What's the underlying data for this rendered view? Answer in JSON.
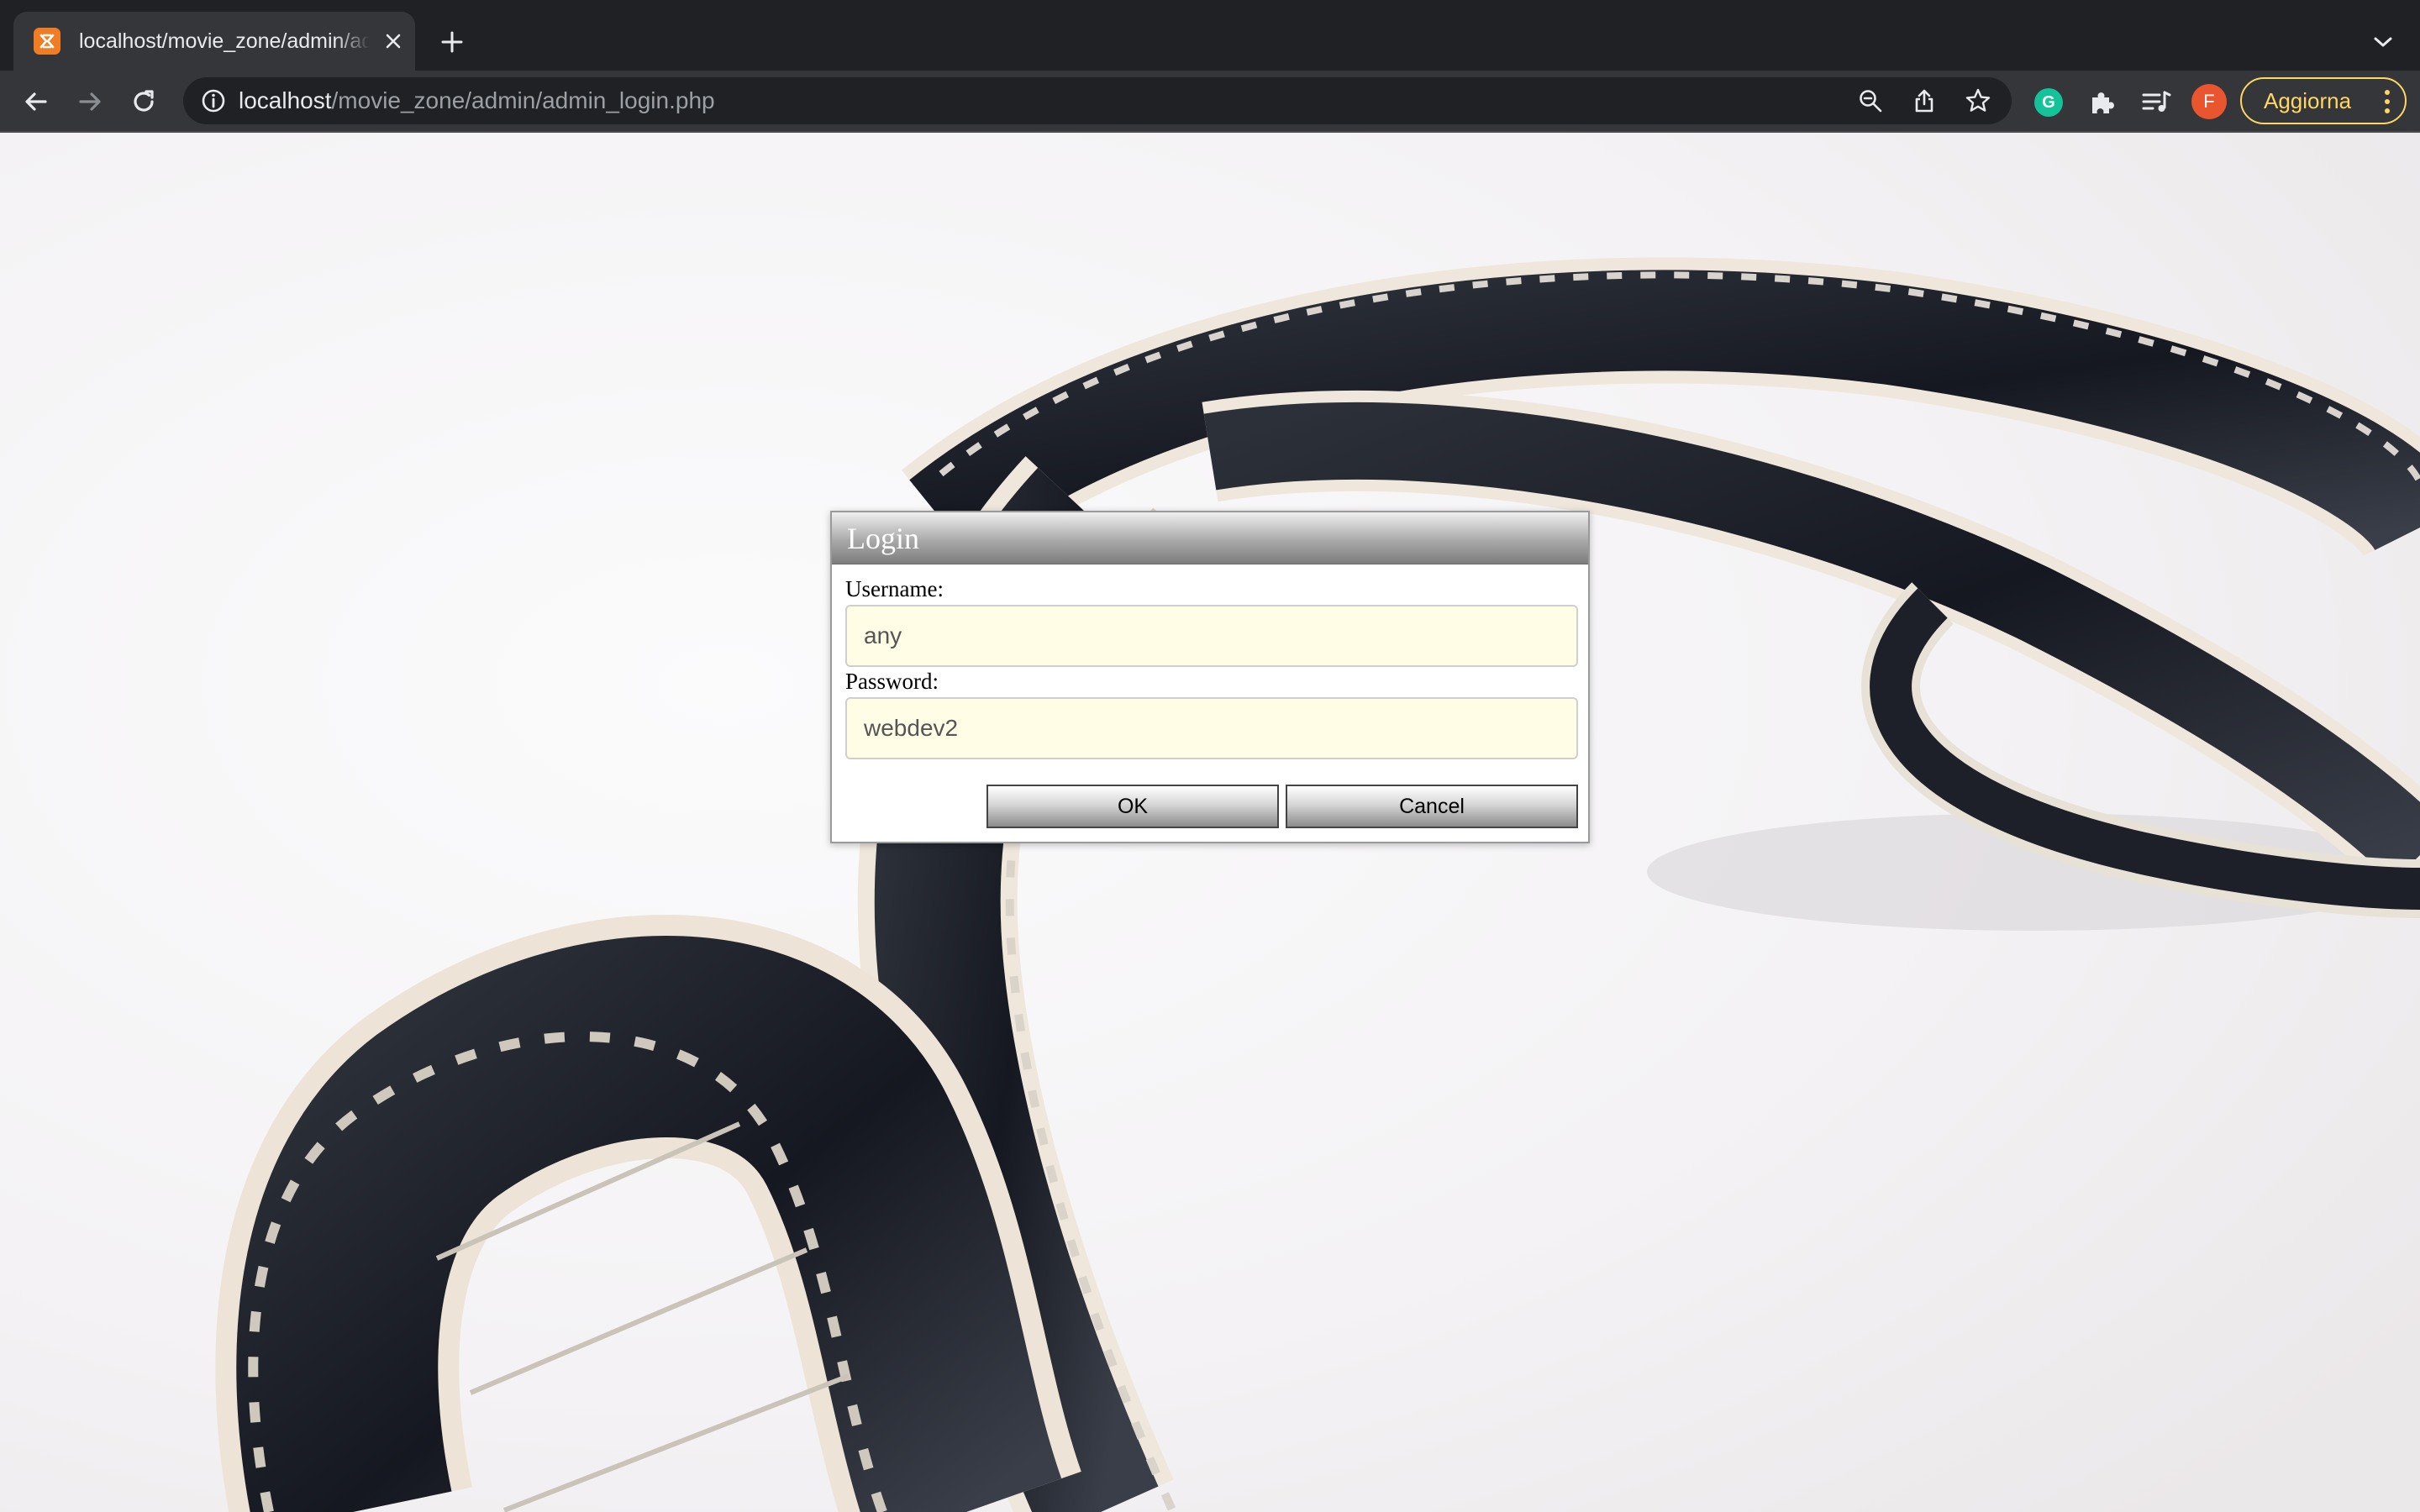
{
  "browser": {
    "tab_title": "localhost/movie_zone/admin/admin_login.php",
    "url_host": "localhost",
    "url_path": "/movie_zone/admin/admin_login.php",
    "profile_initial": "F",
    "update_label": "Aggiorna",
    "grammarly_letter": "G"
  },
  "dialog": {
    "title": "Login",
    "username_label": "Username:",
    "username_value": "any",
    "password_label": "Password:",
    "password_value": "webdev2",
    "ok_label": "OK",
    "cancel_label": "Cancel"
  },
  "colors": {
    "chrome_dark": "#202124",
    "chrome_toolbar": "#35363a",
    "update_accent": "#fdd663",
    "avatar": "#e8552e",
    "field_background": "#fffde6"
  }
}
